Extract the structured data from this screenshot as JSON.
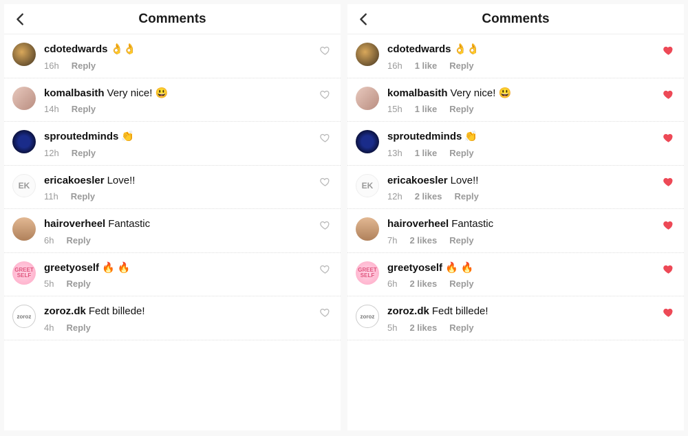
{
  "reply_label": "Reply",
  "panels": [
    {
      "header": {
        "title": "Comments"
      },
      "comments": [
        {
          "username": "cdotedwards",
          "text": "👌👌",
          "time": "16h",
          "likes": "",
          "liked": false,
          "avatar": "av-1",
          "av_text": ""
        },
        {
          "username": "komalbasith",
          "text": "Very nice! 😃",
          "time": "14h",
          "likes": "",
          "liked": false,
          "avatar": "av-2",
          "av_text": ""
        },
        {
          "username": "sproutedminds",
          "text": "👏",
          "time": "12h",
          "likes": "",
          "liked": false,
          "avatar": "av-3",
          "av_text": ""
        },
        {
          "username": "ericakoesler",
          "text": "Love!!",
          "time": "11h",
          "likes": "",
          "liked": false,
          "avatar": "av-4",
          "av_text": "EK"
        },
        {
          "username": "hairoverheel",
          "text": "Fantastic",
          "time": "6h",
          "likes": "",
          "liked": false,
          "avatar": "av-5",
          "av_text": ""
        },
        {
          "username": "greetyoself",
          "text": "🔥 🔥",
          "time": "5h",
          "likes": "",
          "liked": false,
          "avatar": "av-6",
          "av_text": "GREET\nSELF"
        },
        {
          "username": "zoroz.dk",
          "text": "Fedt billede!",
          "time": "4h",
          "likes": "",
          "liked": false,
          "avatar": "av-7",
          "av_text": "zoroz"
        }
      ]
    },
    {
      "header": {
        "title": "Comments"
      },
      "comments": [
        {
          "username": "cdotedwards",
          "text": "👌👌",
          "time": "16h",
          "likes": "1 like",
          "liked": true,
          "avatar": "av-1",
          "av_text": ""
        },
        {
          "username": "komalbasith",
          "text": "Very nice! 😃",
          "time": "15h",
          "likes": "1 like",
          "liked": true,
          "avatar": "av-2",
          "av_text": ""
        },
        {
          "username": "sproutedminds",
          "text": "👏",
          "time": "13h",
          "likes": "1 like",
          "liked": true,
          "avatar": "av-3",
          "av_text": ""
        },
        {
          "username": "ericakoesler",
          "text": "Love!!",
          "time": "12h",
          "likes": "2 likes",
          "liked": true,
          "avatar": "av-4",
          "av_text": "EK"
        },
        {
          "username": "hairoverheel",
          "text": "Fantastic",
          "time": "7h",
          "likes": "2 likes",
          "liked": true,
          "avatar": "av-5",
          "av_text": ""
        },
        {
          "username": "greetyoself",
          "text": "🔥 🔥",
          "time": "6h",
          "likes": "2 likes",
          "liked": true,
          "avatar": "av-6",
          "av_text": "GREET\nSELF"
        },
        {
          "username": "zoroz.dk",
          "text": "Fedt billede!",
          "time": "5h",
          "likes": "2 likes",
          "liked": true,
          "avatar": "av-7",
          "av_text": "zoroz"
        }
      ]
    }
  ]
}
